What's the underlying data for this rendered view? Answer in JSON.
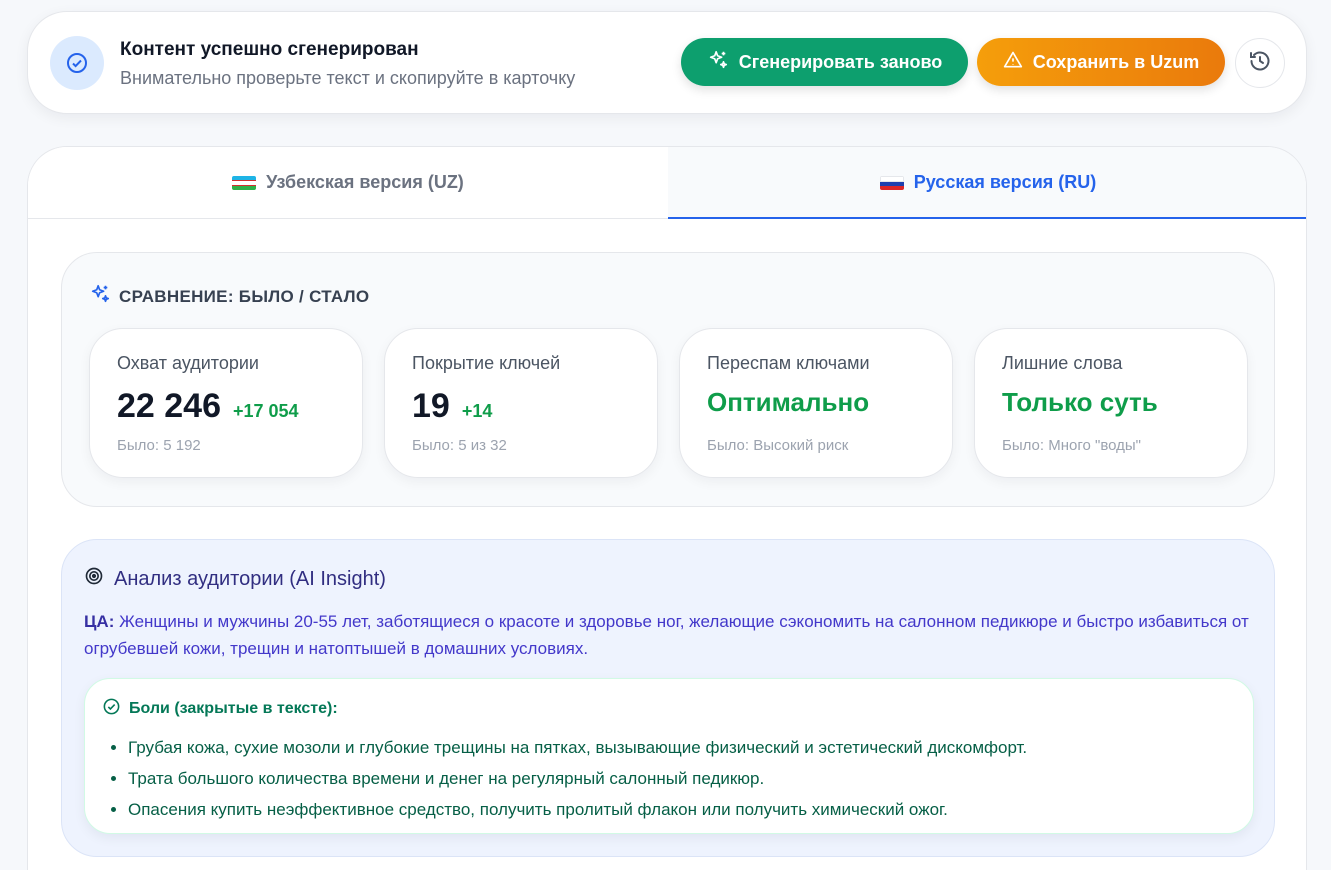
{
  "status": {
    "title": "Контент успешно сгенерирован",
    "subtitle": "Внимательно проверьте текст и скопируйте в карточку",
    "regenerate_label": "Сгенерировать заново",
    "save_label": "Сохранить в Uzum",
    "icons": [
      "check-circle-icon",
      "sparkles-icon",
      "warning-icon",
      "history-icon"
    ]
  },
  "tabs": [
    {
      "label": "Узбекская версия (UZ)",
      "flag": "uz-flag-icon",
      "active": false
    },
    {
      "label": "Русская версия (RU)",
      "flag": "ru-flag-icon",
      "active": true
    }
  ],
  "comparison": {
    "title": "СРАВНЕНИЕ: БЫЛО / СТАЛО",
    "metrics": [
      {
        "label": "Охват аудитории",
        "value": "22 246",
        "delta": "+17 054",
        "before": "Было: 5 192"
      },
      {
        "label": "Покрытие ключей",
        "value": "19",
        "delta": "+14",
        "before": "Было: 5 из 32"
      },
      {
        "label": "Переспам ключами",
        "value": "Оптимально",
        "delta": "",
        "before": "Было: Высокий риск"
      },
      {
        "label": "Лишние слова",
        "value": "Только суть",
        "delta": "",
        "before": "Было: Много \"воды\""
      }
    ]
  },
  "audience": {
    "title": "Анализ аудитории (AI Insight)",
    "ta_label": "ЦА:",
    "ta_text": "Женщины и мужчины 20-55 лет, заботящиеся о красоте и здоровье ног, желающие сэкономить на салонном педикюре и быстро избавиться от огрубевшей кожи, трещин и натоптышей в домашних условиях.",
    "pains_title": "Боли (закрытые в тексте):",
    "pains": [
      "Грубая кожа, сухие мозоли и глубокие трещины на пятках, вызывающие физический и эстетический дискомфорт.",
      "Трата большого количества времени и денег на регулярный салонный педикюр.",
      "Опасения купить неэффективное средство, получить пролитый флакон или получить химический ожог."
    ]
  },
  "colors": {
    "accent_blue": "#2563eb",
    "regenerate_green": "#0d9f6e",
    "save_orange": "#f59e0b",
    "success_green": "#0f9d4a"
  }
}
